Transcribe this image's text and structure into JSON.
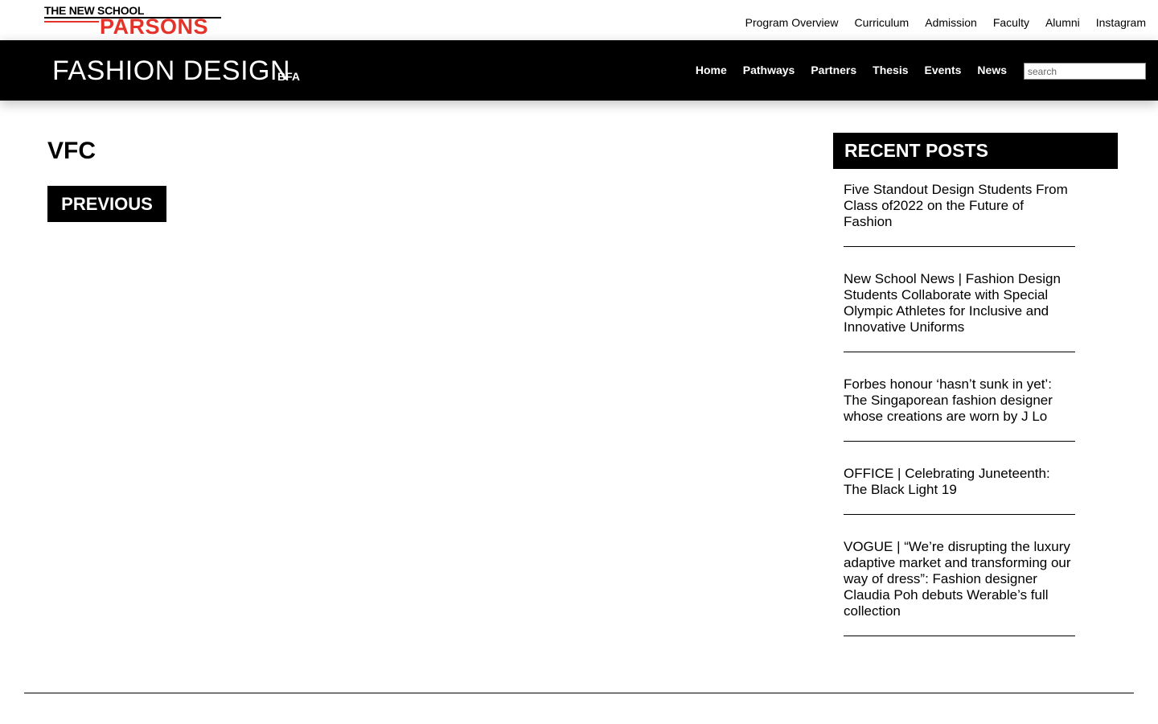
{
  "logo": {
    "line1": "THE NEW SCHOOL",
    "line2": "PARSONS",
    "accent_color": "#e5332a"
  },
  "top_nav": [
    {
      "label": "Program Overview"
    },
    {
      "label": "Curriculum"
    },
    {
      "label": "Admission"
    },
    {
      "label": "Faculty"
    },
    {
      "label": "Alumni"
    },
    {
      "label": "Instagram"
    }
  ],
  "header": {
    "title": "FASHION DESIGN",
    "subtitle": "BFA",
    "background_color": "#000000"
  },
  "main_nav": [
    {
      "label": "Home"
    },
    {
      "label": "Pathways"
    },
    {
      "label": "Partners"
    },
    {
      "label": "Thesis"
    },
    {
      "label": "Events"
    },
    {
      "label": "News"
    }
  ],
  "search": {
    "placeholder": "search",
    "value": ""
  },
  "content": {
    "title": "VFC",
    "previous_label": "PREVIOUS"
  },
  "sidebar": {
    "heading": "RECENT POSTS",
    "posts": [
      {
        "title": "Five Standout Design Students From Class of2022 on the Future of Fashion"
      },
      {
        "title": "New School News | Fashion Design Students Collaborate with Special Olympic Athletes for Inclusive and Innovative Uniforms"
      },
      {
        "title": "Forbes honour ‘hasn’t sunk in yet’: The Singaporean fashion designer whose creations are worn by J Lo"
      },
      {
        "title": "OFFICE | Celebrating Juneteenth: The Black Light 19"
      },
      {
        "title": "VOGUE | “We’re disrupting the luxury adaptive market and transforming our way of dress”: Fashion designer Claudia Poh debuts Werable’s full collection"
      }
    ]
  }
}
